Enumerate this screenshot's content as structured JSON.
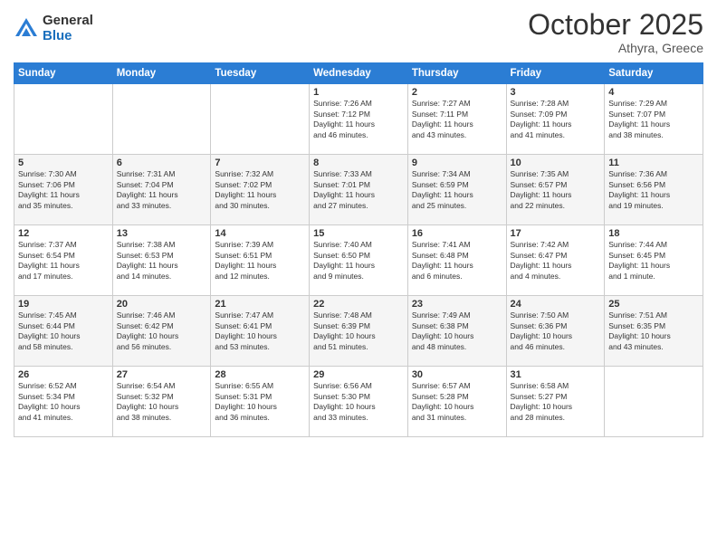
{
  "logo": {
    "general": "General",
    "blue": "Blue"
  },
  "header": {
    "month": "October 2025",
    "location": "Athyra, Greece"
  },
  "weekdays": [
    "Sunday",
    "Monday",
    "Tuesday",
    "Wednesday",
    "Thursday",
    "Friday",
    "Saturday"
  ],
  "weeks": [
    [
      {
        "day": "",
        "info": ""
      },
      {
        "day": "",
        "info": ""
      },
      {
        "day": "",
        "info": ""
      },
      {
        "day": "1",
        "info": "Sunrise: 7:26 AM\nSunset: 7:12 PM\nDaylight: 11 hours\nand 46 minutes."
      },
      {
        "day": "2",
        "info": "Sunrise: 7:27 AM\nSunset: 7:11 PM\nDaylight: 11 hours\nand 43 minutes."
      },
      {
        "day": "3",
        "info": "Sunrise: 7:28 AM\nSunset: 7:09 PM\nDaylight: 11 hours\nand 41 minutes."
      },
      {
        "day": "4",
        "info": "Sunrise: 7:29 AM\nSunset: 7:07 PM\nDaylight: 11 hours\nand 38 minutes."
      }
    ],
    [
      {
        "day": "5",
        "info": "Sunrise: 7:30 AM\nSunset: 7:06 PM\nDaylight: 11 hours\nand 35 minutes."
      },
      {
        "day": "6",
        "info": "Sunrise: 7:31 AM\nSunset: 7:04 PM\nDaylight: 11 hours\nand 33 minutes."
      },
      {
        "day": "7",
        "info": "Sunrise: 7:32 AM\nSunset: 7:02 PM\nDaylight: 11 hours\nand 30 minutes."
      },
      {
        "day": "8",
        "info": "Sunrise: 7:33 AM\nSunset: 7:01 PM\nDaylight: 11 hours\nand 27 minutes."
      },
      {
        "day": "9",
        "info": "Sunrise: 7:34 AM\nSunset: 6:59 PM\nDaylight: 11 hours\nand 25 minutes."
      },
      {
        "day": "10",
        "info": "Sunrise: 7:35 AM\nSunset: 6:57 PM\nDaylight: 11 hours\nand 22 minutes."
      },
      {
        "day": "11",
        "info": "Sunrise: 7:36 AM\nSunset: 6:56 PM\nDaylight: 11 hours\nand 19 minutes."
      }
    ],
    [
      {
        "day": "12",
        "info": "Sunrise: 7:37 AM\nSunset: 6:54 PM\nDaylight: 11 hours\nand 17 minutes."
      },
      {
        "day": "13",
        "info": "Sunrise: 7:38 AM\nSunset: 6:53 PM\nDaylight: 11 hours\nand 14 minutes."
      },
      {
        "day": "14",
        "info": "Sunrise: 7:39 AM\nSunset: 6:51 PM\nDaylight: 11 hours\nand 12 minutes."
      },
      {
        "day": "15",
        "info": "Sunrise: 7:40 AM\nSunset: 6:50 PM\nDaylight: 11 hours\nand 9 minutes."
      },
      {
        "day": "16",
        "info": "Sunrise: 7:41 AM\nSunset: 6:48 PM\nDaylight: 11 hours\nand 6 minutes."
      },
      {
        "day": "17",
        "info": "Sunrise: 7:42 AM\nSunset: 6:47 PM\nDaylight: 11 hours\nand 4 minutes."
      },
      {
        "day": "18",
        "info": "Sunrise: 7:44 AM\nSunset: 6:45 PM\nDaylight: 11 hours\nand 1 minute."
      }
    ],
    [
      {
        "day": "19",
        "info": "Sunrise: 7:45 AM\nSunset: 6:44 PM\nDaylight: 10 hours\nand 58 minutes."
      },
      {
        "day": "20",
        "info": "Sunrise: 7:46 AM\nSunset: 6:42 PM\nDaylight: 10 hours\nand 56 minutes."
      },
      {
        "day": "21",
        "info": "Sunrise: 7:47 AM\nSunset: 6:41 PM\nDaylight: 10 hours\nand 53 minutes."
      },
      {
        "day": "22",
        "info": "Sunrise: 7:48 AM\nSunset: 6:39 PM\nDaylight: 10 hours\nand 51 minutes."
      },
      {
        "day": "23",
        "info": "Sunrise: 7:49 AM\nSunset: 6:38 PM\nDaylight: 10 hours\nand 48 minutes."
      },
      {
        "day": "24",
        "info": "Sunrise: 7:50 AM\nSunset: 6:36 PM\nDaylight: 10 hours\nand 46 minutes."
      },
      {
        "day": "25",
        "info": "Sunrise: 7:51 AM\nSunset: 6:35 PM\nDaylight: 10 hours\nand 43 minutes."
      }
    ],
    [
      {
        "day": "26",
        "info": "Sunrise: 6:52 AM\nSunset: 5:34 PM\nDaylight: 10 hours\nand 41 minutes."
      },
      {
        "day": "27",
        "info": "Sunrise: 6:54 AM\nSunset: 5:32 PM\nDaylight: 10 hours\nand 38 minutes."
      },
      {
        "day": "28",
        "info": "Sunrise: 6:55 AM\nSunset: 5:31 PM\nDaylight: 10 hours\nand 36 minutes."
      },
      {
        "day": "29",
        "info": "Sunrise: 6:56 AM\nSunset: 5:30 PM\nDaylight: 10 hours\nand 33 minutes."
      },
      {
        "day": "30",
        "info": "Sunrise: 6:57 AM\nSunset: 5:28 PM\nDaylight: 10 hours\nand 31 minutes."
      },
      {
        "day": "31",
        "info": "Sunrise: 6:58 AM\nSunset: 5:27 PM\nDaylight: 10 hours\nand 28 minutes."
      },
      {
        "day": "",
        "info": ""
      }
    ]
  ]
}
